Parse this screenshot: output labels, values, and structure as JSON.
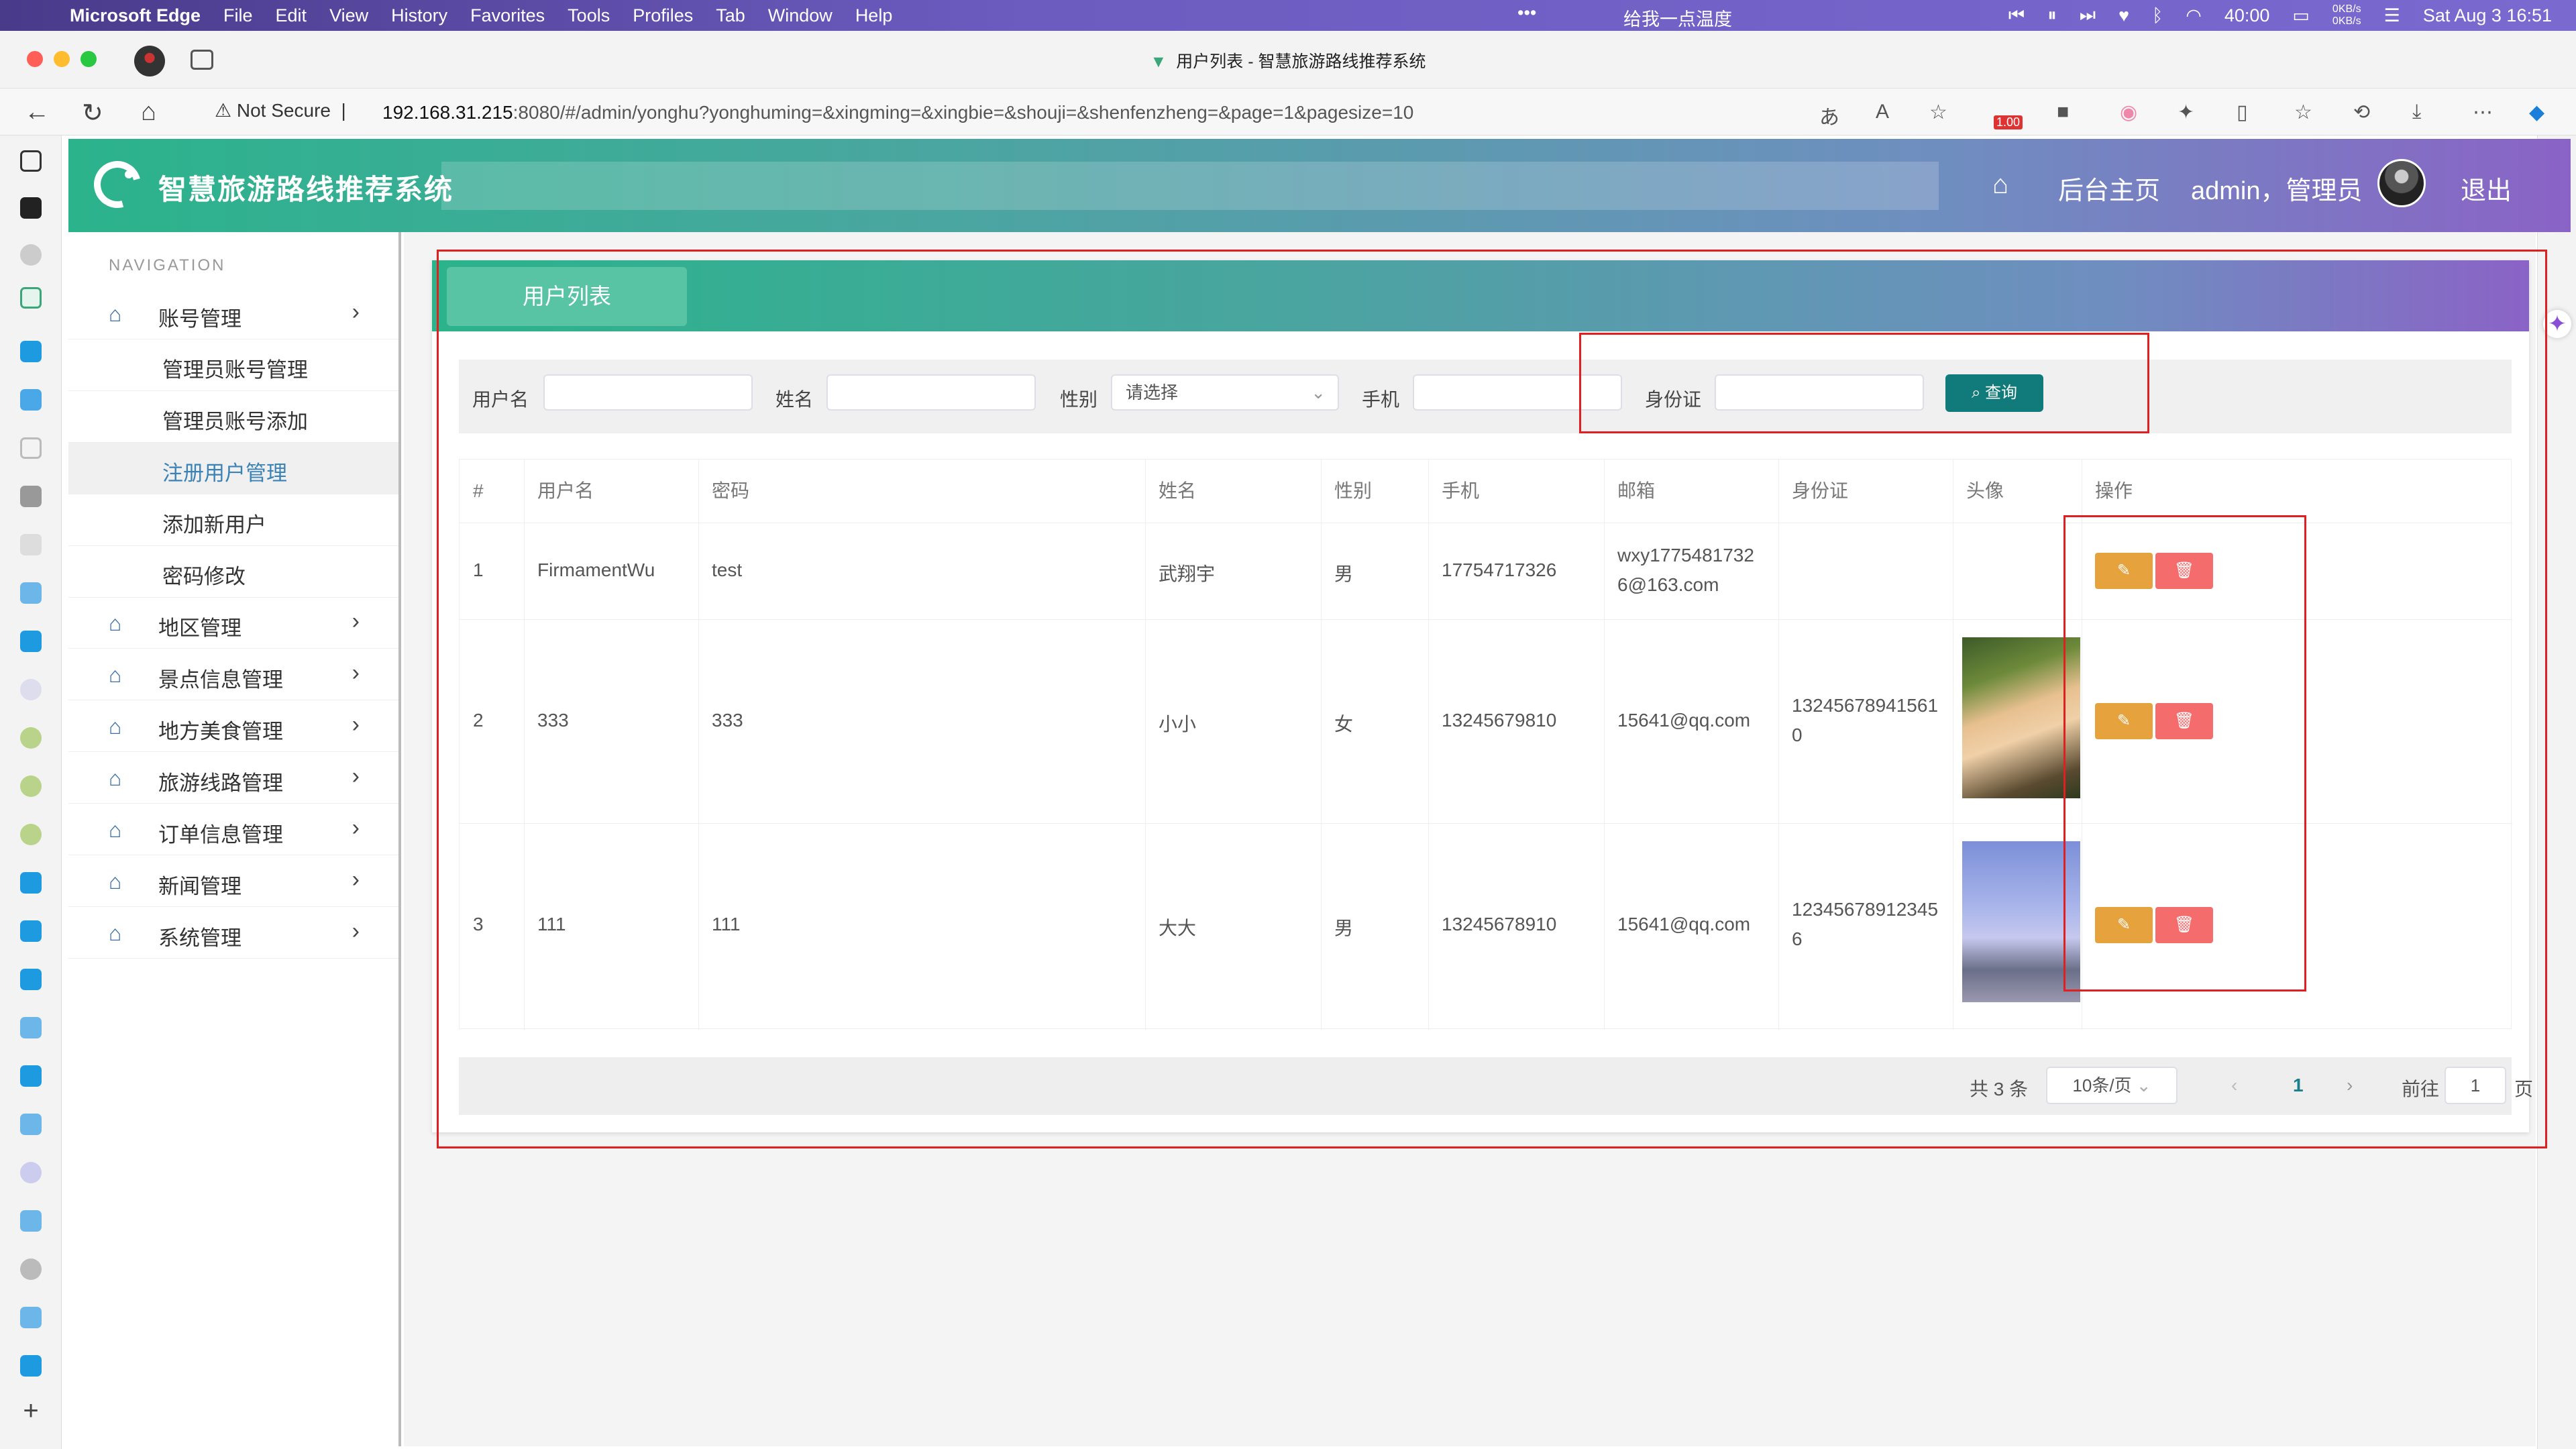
{
  "os_menubar": {
    "app": "Microsoft Edge",
    "menus": [
      "File",
      "Edit",
      "View",
      "History",
      "Favorites",
      "Tools",
      "Profiles",
      "Tab",
      "Window",
      "Help"
    ],
    "center_text": "给我一点温度",
    "clock": "40:00",
    "net_up": "0KB/s",
    "net_down": "0KB/s",
    "date_time": "Sat Aug 3  16:51"
  },
  "browser": {
    "tab_title": "用户列表 - 智慧旅游路线推荐系统",
    "security_label": "Not Secure",
    "url_host": "192.168.31.215",
    "url_rest": ":8080/#/admin/yonghu?yonghuming=&xingming=&xingbie=&shouji=&shenfenzheng=&page=1&pagesize=10",
    "ext_badge": "1.00"
  },
  "header": {
    "title": "智慧旅游路线推荐系统",
    "home_label": "后台主页",
    "user_label": "admin，管理员",
    "logout_label": "退出"
  },
  "sidebar": {
    "nav_label": "NAVIGATION",
    "account_group": "账号管理",
    "sub_items": [
      "管理员账号管理",
      "管理员账号添加",
      "注册用户管理",
      "添加新用户",
      "密码修改"
    ],
    "groups": [
      "地区管理",
      "景点信息管理",
      "地方美食管理",
      "旅游线路管理",
      "订单信息管理",
      "新闻管理",
      "系统管理"
    ]
  },
  "panel": {
    "tab_label": "用户列表"
  },
  "search": {
    "username_label": "用户名",
    "name_label": "姓名",
    "gender_label": "性别",
    "gender_placeholder": "请选择",
    "phone_label": "手机",
    "idcard_label": "身份证",
    "query_button": "查询"
  },
  "table": {
    "headers": [
      "#",
      "用户名",
      "密码",
      "姓名",
      "性别",
      "手机",
      "邮箱",
      "身份证",
      "头像",
      "操作"
    ],
    "rows": [
      {
        "no": "1",
        "username": "FirmamentWu",
        "password": "test",
        "name": "武翔宇",
        "gender": "男",
        "phone": "17754717326",
        "email_l1": "wxy1775481732",
        "email_l2": "6@163.com",
        "id_l1": "",
        "id_l2": ""
      },
      {
        "no": "2",
        "username": "333",
        "password": "333",
        "name": "小小",
        "gender": "女",
        "phone": "13245679810",
        "email_l1": "15641@qq.com",
        "email_l2": "",
        "id_l1": "13245678941561",
        "id_l2": "0"
      },
      {
        "no": "3",
        "username": "111",
        "password": "111",
        "name": "大大",
        "gender": "男",
        "phone": "13245678910",
        "email_l1": "15641@qq.com",
        "email_l2": "",
        "id_l1": "12345678912345",
        "id_l2": "6"
      }
    ],
    "edit_icon": "✎",
    "delete_icon": "🗑"
  },
  "pager": {
    "total": "共 3 条",
    "page_size": "10条/页",
    "current_page": "1",
    "goto_label": "前往",
    "goto_value": "1",
    "page_suffix": "页"
  },
  "colors": {
    "header_start": "#2bb38c",
    "header_end": "#8a63c6",
    "query_btn": "#117a7a",
    "edit_btn": "#e6a23c",
    "delete_btn": "#f56c6c",
    "highlight_box": "#e02020"
  }
}
